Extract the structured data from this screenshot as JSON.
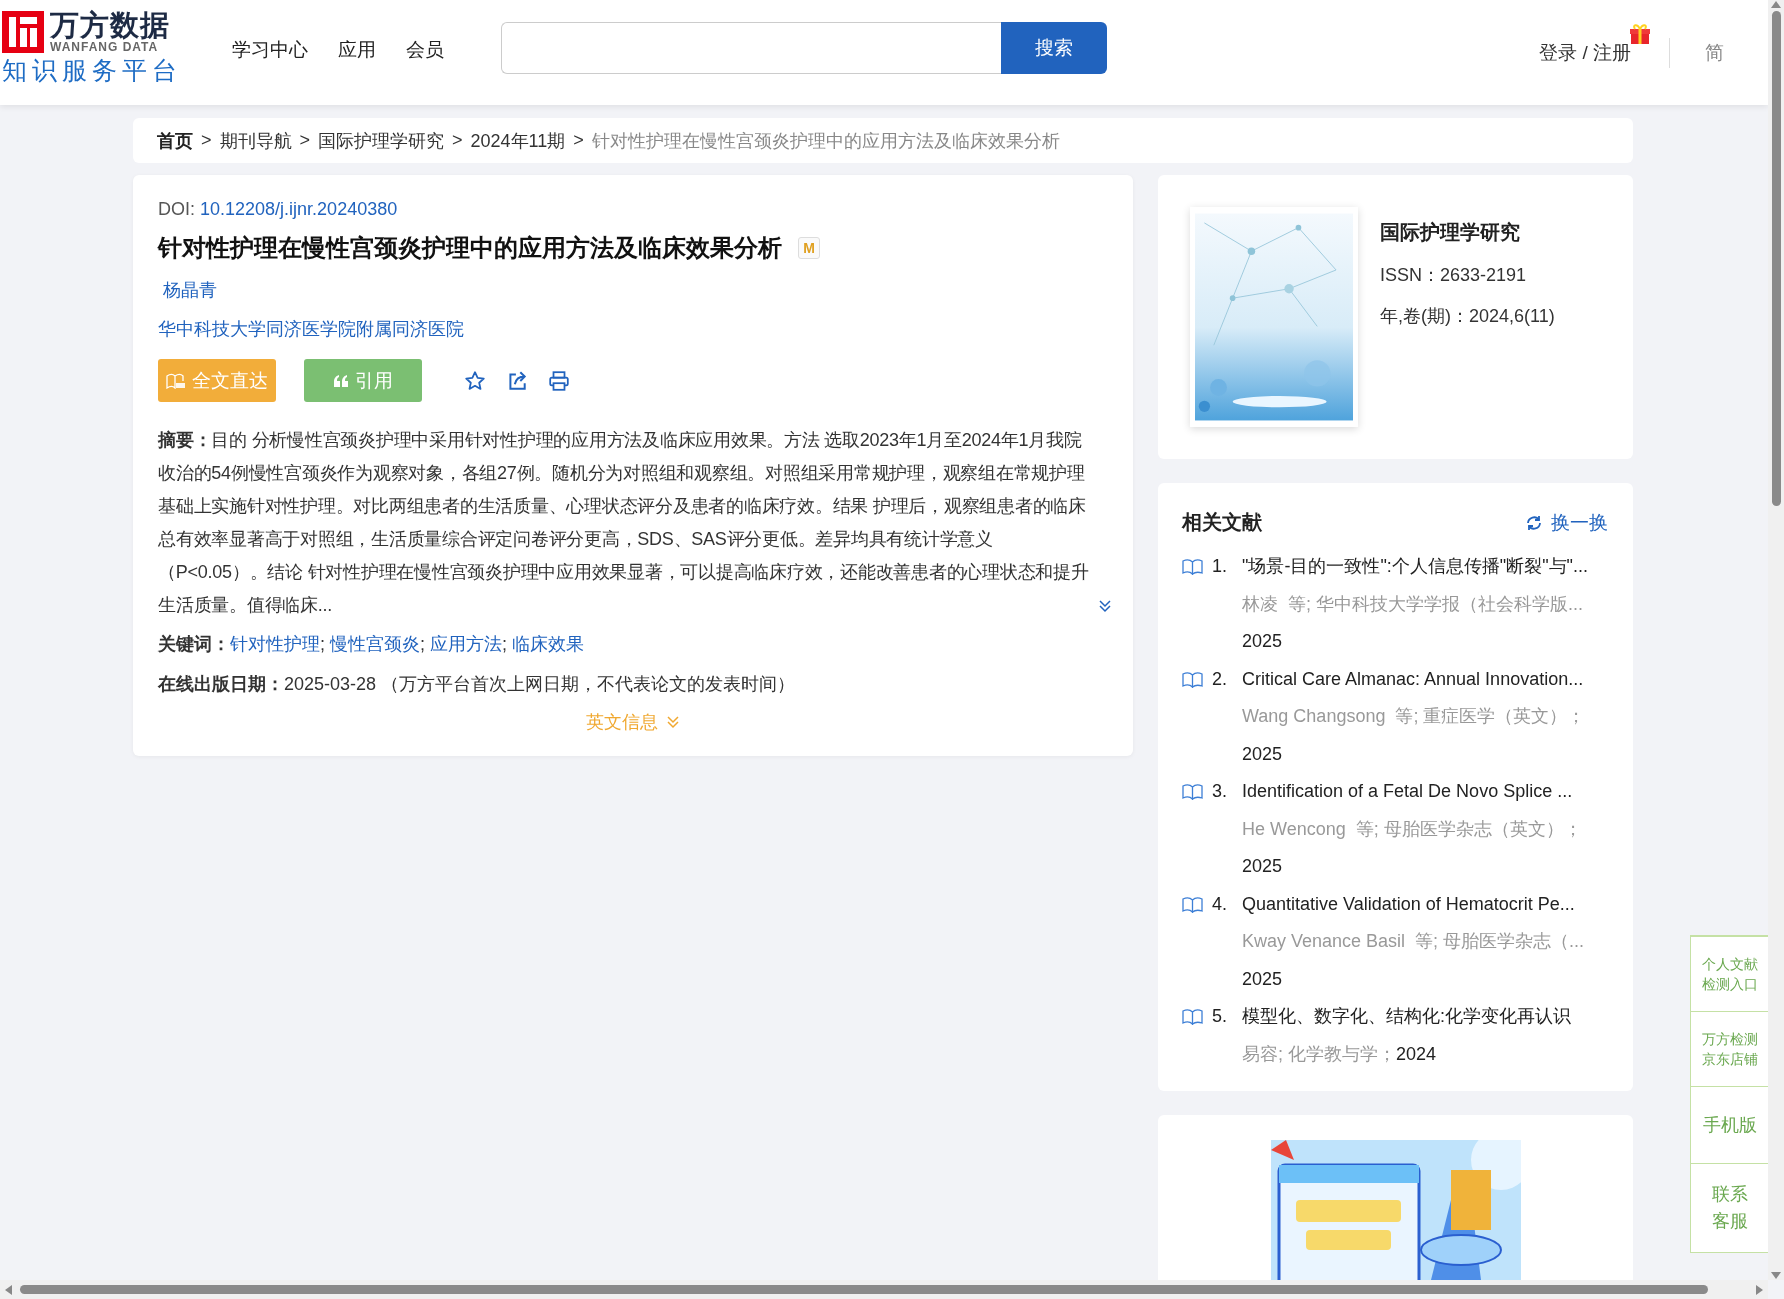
{
  "header": {
    "logo": {
      "name": "万方数据",
      "latin": "WANFANG DATA",
      "slogan": "知识服务平台"
    },
    "nav": [
      "学习中心",
      "应用",
      "会员"
    ],
    "search": {
      "button": "搜索"
    },
    "login": "登录 / 注册",
    "languages": [
      {
        "label": "简",
        "selected": true
      }
    ]
  },
  "breadcrumb": {
    "separator": ">",
    "items": [
      {
        "label": "首页",
        "kind": "home"
      },
      {
        "label": "期刊导航",
        "kind": "link"
      },
      {
        "label": "国际护理学研究",
        "kind": "link"
      },
      {
        "label": "2024年11期",
        "kind": "link"
      },
      {
        "label": "针对性护理在慢性宫颈炎护理中的应用方法及临床效果分析",
        "kind": "current"
      }
    ]
  },
  "article": {
    "doi_label": "DOI:",
    "doi": "10.12208/j.ijnr.20240380",
    "title": "针对性护理在慢性宫颈炎护理中的应用方法及临床效果分析",
    "badge": "M",
    "authors": [
      "杨晶青"
    ],
    "affiliation": "华中科技大学同济医学院附属同济医院",
    "actions": [
      {
        "kind": "fulltext",
        "label": "全文直达"
      },
      {
        "kind": "cite",
        "label": "引用"
      },
      {
        "kind": "favorite"
      },
      {
        "kind": "share"
      },
      {
        "kind": "print"
      }
    ],
    "abstract": "**摘要：**目的 分析慢性宫颈炎护理中采用针对性护理的应用方法及临床应用效果。方法 选取2023年1月至2024年1月我院收治的54例慢性宫颈炎作为观察对象，各组27例。随机分为对照组和观察组。对照组采用常规护理，观察组在常规护理基础上实施针对性护理。对比两组患者的生活质量、心理状态评分及患者的临床疗效。结果 护理后，观察组患者的临床总有效率显著高于对照组，生活质量综合评定问卷评分更高，SDS、SAS评分更低。差异均具有统计学意义（P<0.05）。结论 针对性护理在慢性宫颈炎护理中应用效果显著，可以提高临床疗效，还能改善患者的心理状态和提升生活质量。值得临床...",
    "keywords_label": "关键词：",
    "keywords": [
      "针对性护理",
      "慢性宫颈炎",
      "应用方法",
      "临床效果"
    ],
    "keyword_separator": ";",
    "date": "**在线出版日期：**2025-03-28 （万方平台首次上网日期，不代表论文的发表时间）",
    "english_toggle": "英文信息"
  },
  "journal": {
    "title": "国际护理学研究",
    "issn": "ISSN：2633-2191",
    "volume": "年,卷(期)：2024,6(11)"
  },
  "related": {
    "title": "相关文献",
    "refresh": "换一换",
    "items": [
      {
        "number": "1.",
        "title": "\"场景-目的一致性\":个人信息传播\"断裂\"与\"...",
        "meta": "林凌  等; 华中科技大学学报（社会科学版...",
        "year": "2025",
        "kind": "wrapped"
      },
      {
        "number": "2.",
        "title": "Critical Care Almanac: Annual Innovation...",
        "meta": "Wang Changsong  等; 重症医学（英文）；",
        "year": "2025",
        "kind": "wrapped"
      },
      {
        "number": "3.",
        "title": "Identification of a Fetal De Novo Splice ...",
        "meta": "He Wencong  等; 母胎医学杂志（英文）；",
        "year": "2025",
        "kind": "wrapped"
      },
      {
        "number": "4.",
        "title": "Quantitative Validation of Hematocrit Pe...",
        "meta": "Kway Venance Basil  等; 母胎医学杂志（...",
        "year": "2025",
        "kind": "wrapped"
      },
      {
        "number": "5.",
        "title": "模型化、数字化、结构化:化学变化再认识",
        "meta": "易容; 化学教与学；",
        "year": "2024",
        "kind": "inline"
      }
    ]
  },
  "float_panel": [
    {
      "label": "个人文献检测入口",
      "kind": "small"
    },
    {
      "label": "万方检测京东店铺",
      "kind": "small"
    },
    {
      "label": "手机版",
      "kind": "large"
    },
    {
      "label": "联系客服",
      "kind": "large"
    }
  ]
}
